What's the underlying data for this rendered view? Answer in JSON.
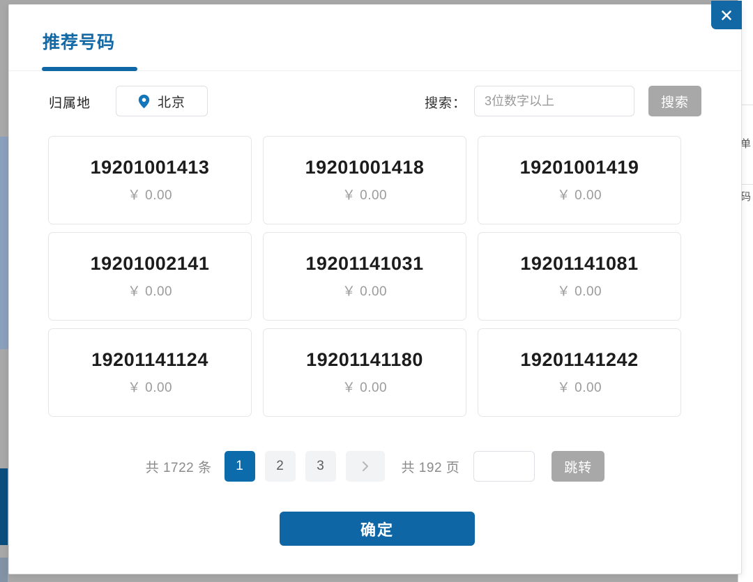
{
  "colors": {
    "accent_blue": "#0f66a4",
    "active_page_blue": "#0c6cab",
    "gray_button": "#a8a8a8",
    "card_border": "#e6e6e6",
    "muted_text": "#9b9b9b"
  },
  "dialog": {
    "close_icon": "close-icon",
    "tabs": [
      {
        "label": "推荐号码",
        "active": true
      }
    ]
  },
  "filters": {
    "region_label": "归属地",
    "region_value": "北京",
    "region_icon": "location-pin-icon",
    "search_label": "搜索：",
    "search_value": "",
    "search_placeholder": "3位数字以上",
    "search_button_label": "搜索"
  },
  "numbers": [
    {
      "number": "19201001413",
      "price": "￥ 0.00"
    },
    {
      "number": "19201001418",
      "price": "￥ 0.00"
    },
    {
      "number": "19201001419",
      "price": "￥ 0.00"
    },
    {
      "number": "19201002141",
      "price": "￥ 0.00"
    },
    {
      "number": "19201141031",
      "price": "￥ 0.00"
    },
    {
      "number": "19201141081",
      "price": "￥ 0.00"
    },
    {
      "number": "19201141124",
      "price": "￥ 0.00"
    },
    {
      "number": "19201141180",
      "price": "￥ 0.00"
    },
    {
      "number": "19201141242",
      "price": "￥ 0.00"
    }
  ],
  "pagination": {
    "total_label": "共 1722 条",
    "pages": [
      "1",
      "2",
      "3"
    ],
    "current_page": "1",
    "next_icon": "chevron-right-icon",
    "page_count_label": "共 192 页",
    "jump_value": "",
    "jump_button_label": "跳转"
  },
  "footer": {
    "confirm_label": "确定"
  },
  "background": {
    "right_column_fragments": [
      "单",
      "码"
    ]
  }
}
